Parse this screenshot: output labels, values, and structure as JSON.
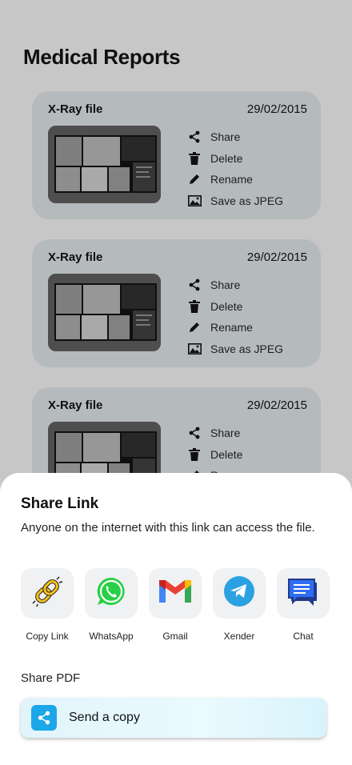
{
  "page": {
    "title": "Medical Reports"
  },
  "cards": [
    {
      "title": "X-Ray file",
      "date": "29/02/2015",
      "actions": [
        {
          "label": "Share",
          "icon": "share-icon"
        },
        {
          "label": "Delete",
          "icon": "trash-icon"
        },
        {
          "label": "Rename",
          "icon": "pencil-icon"
        },
        {
          "label": "Save as JPEG",
          "icon": "image-icon"
        }
      ]
    },
    {
      "title": "X-Ray file",
      "date": "29/02/2015",
      "actions": [
        {
          "label": "Share",
          "icon": "share-icon"
        },
        {
          "label": "Delete",
          "icon": "trash-icon"
        },
        {
          "label": "Rename",
          "icon": "pencil-icon"
        },
        {
          "label": "Save as JPEG",
          "icon": "image-icon"
        }
      ]
    },
    {
      "title": "X-Ray file",
      "date": "29/02/2015",
      "actions": [
        {
          "label": "Share",
          "icon": "share-icon"
        },
        {
          "label": "Delete",
          "icon": "trash-icon"
        },
        {
          "label": "Rename",
          "icon": "pencil-icon"
        }
      ]
    }
  ],
  "sheet": {
    "title": "Share Link",
    "description": "Anyone on the internet with this link can access the file.",
    "options": [
      {
        "label": "Copy Link",
        "icon": "link-icon"
      },
      {
        "label": "WhatsApp",
        "icon": "whatsapp-icon"
      },
      {
        "label": "Gmail",
        "icon": "gmail-icon"
      },
      {
        "label": "Xender",
        "icon": "telegram-icon"
      },
      {
        "label": "Chat",
        "icon": "chat-icon"
      }
    ],
    "share_pdf_label": "Share PDF",
    "send_copy_label": "Send a copy"
  }
}
